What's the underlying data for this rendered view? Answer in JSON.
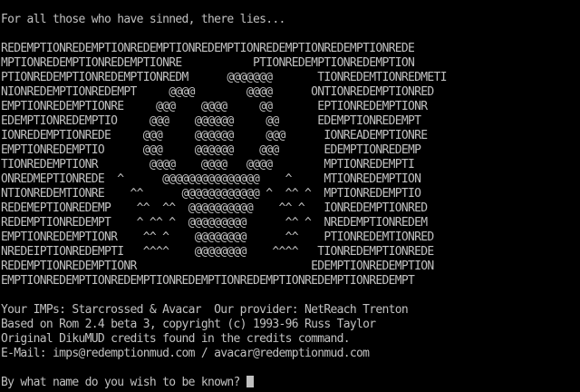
{
  "screen": {
    "background_color": "#000000",
    "text_color": "#c0c0c0",
    "intro_line": "For all those who have sinned, there lies...",
    "banner": [
      "REDEMPTIONREDEMPTIONREDEMPTIONREDEMPTIONREDEMPTIONREDEMPTIONREDE",
      "MPTIONREDEMPTIONREDEMPTIONRE           PTIONREDEMPTIONREDEMPTION",
      "PTIONREDEMPTIONREDEMPTIONREDM      @@@@@@@       TIONREDEMTIONREDMETI",
      "NIONREDEMPTIONREDEMPT     @@@@        @@@@      ONTIONREDEMPTIONRED",
      "EMPTIONREDEMPTIONRE     @@@    @@@@     @@       EPTIONREDEMPTIONR",
      "EDEMPTIONREDEMPTIO     @@@    @@@@@@     @@      EDEMPTIONREDEMPT",
      "IONREDEMPTIONREDE     @@@     @@@@@@     @@@      IONREADEMPTIONRE",
      "EMPTIONREDEMPTIO      @@@     @@@@@@    @@@       EDEMPTIONREDEMP",
      "TIONREDEMPTIONR        @@@@    @@@@   @@@@        MPTIONREDEMPTI",
      "ONREDMEPTIONREDE  ^      @@@@@@@@@@@@@@@    ^     MTIONREDEMPTION",
      "NTIONREDEMTIONRE    ^^      @@@@@@@@@@@@ ^  ^^ ^  MPTIONREDEMPTIO",
      "REDEMEPTIONREDEMP    ^^  ^^  @@@@@@@@@@    ^^ ^   IONREDEMPTIONRED",
      "REDEMPTIONREDEMPT    ^ ^^ ^  @@@@@@@@@      ^^ ^  NREDEMPTIONREDEM",
      "EMPTIONREDEMPTIONR    ^^ ^    @@@@@@@@      ^^    PTIONREDEMTIONRED",
      "NREDEIPTIONREDEMPTI   ^^^^    @@@@@@@@    ^^^^   TIONREDEMPTIONREDE",
      "REDEMPTIONREDEMPTIONR                           EDEMPTIONREDEMPTION",
      "EMPTIONREDEMPTIONREDEMPTIONREDEMPTIONREDEMPTIONREDEMPTIONREDEMPT"
    ],
    "credits": [
      "Your IMPs: Starcrossed & Avacar  Our provider: NetReach Trenton",
      "Based on Rom 2.4 beta 3, copyright (c) 1993-96 Russ Taylor",
      "Original DikuMUD credits found in the credits command.",
      "E-Mail: imps@redemptionmud.com / avacar@redemptionmud.com"
    ],
    "prompt": "By what name do you wish to be known?"
  }
}
